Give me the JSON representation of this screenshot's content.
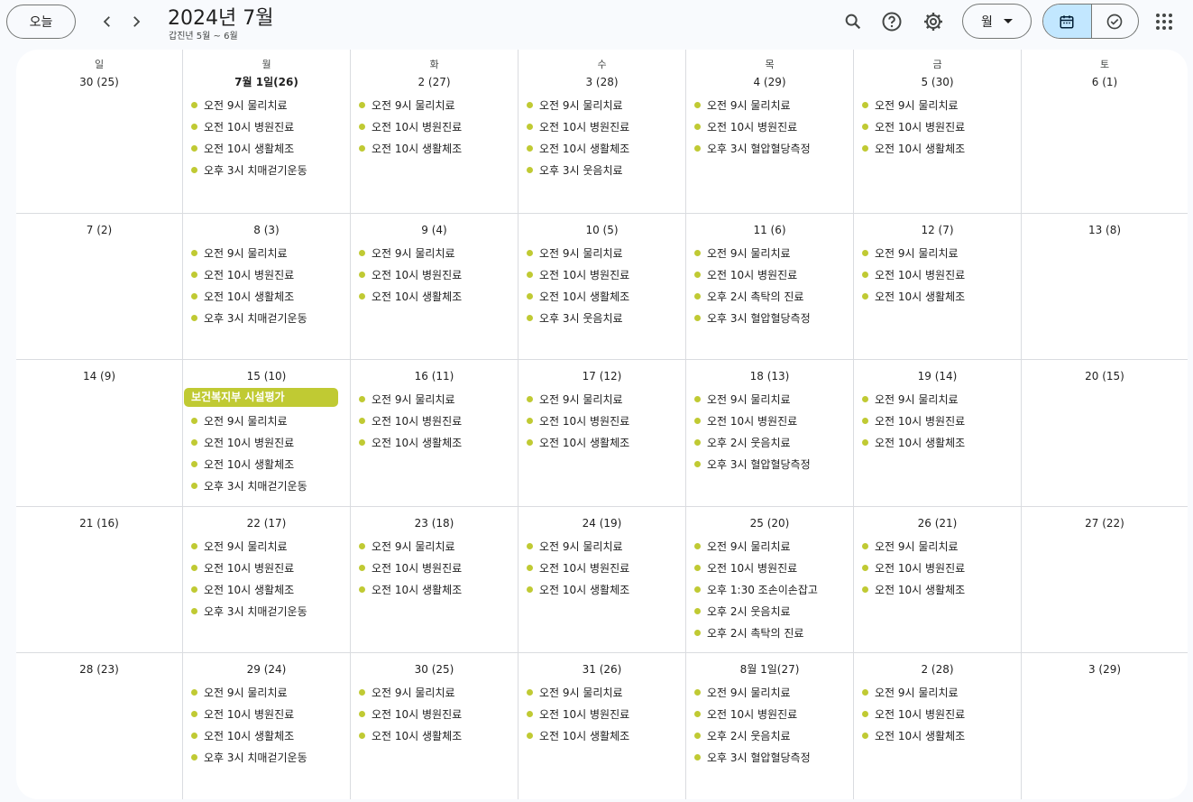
{
  "header": {
    "today_label": "오늘",
    "title": "2024년 7월",
    "subtitle": "갑진년 5월 ~ 6월",
    "view_label": "월",
    "icons": [
      "chevron-left-icon",
      "chevron-right-icon",
      "search-icon",
      "help-icon",
      "gear-icon",
      "calendar-icon",
      "tasks-icon",
      "apps-grid-icon"
    ]
  },
  "colors": {
    "event": "#c0ca33",
    "accent": "#c2e7ff"
  },
  "weekdays": [
    "일",
    "월",
    "화",
    "수",
    "목",
    "금",
    "토"
  ],
  "weeks": [
    [
      {
        "date": "30 (25)",
        "events": []
      },
      {
        "date": "7월 1일(26)",
        "bold": true,
        "events": [
          "오전 9시 물리치료",
          "오전 10시 병원진료",
          "오전 10시 생활체조",
          "오후 3시 치매걷기운동"
        ]
      },
      {
        "date": "2 (27)",
        "events": [
          "오전 9시 물리치료",
          "오전 10시 병원진료",
          "오전 10시 생활체조"
        ]
      },
      {
        "date": "3 (28)",
        "events": [
          "오전 9시 물리치료",
          "오전 10시 병원진료",
          "오전 10시 생활체조",
          "오후 3시 웃음치료"
        ]
      },
      {
        "date": "4 (29)",
        "events": [
          "오전 9시 물리치료",
          "오전 10시 병원진료",
          "오후 3시 혈압혈당측정"
        ]
      },
      {
        "date": "5 (30)",
        "events": [
          "오전 9시 물리치료",
          "오전 10시 병원진료",
          "오전 10시 생활체조"
        ]
      },
      {
        "date": "6 (1)",
        "events": []
      }
    ],
    [
      {
        "date": "7 (2)",
        "events": []
      },
      {
        "date": "8 (3)",
        "events": [
          "오전 9시 물리치료",
          "오전 10시 병원진료",
          "오전 10시 생활체조",
          "오후 3시 치매걷기운동"
        ]
      },
      {
        "date": "9 (4)",
        "events": [
          "오전 9시 물리치료",
          "오전 10시 병원진료",
          "오전 10시 생활체조"
        ]
      },
      {
        "date": "10 (5)",
        "events": [
          "오전 9시 물리치료",
          "오전 10시 병원진료",
          "오전 10시 생활체조",
          "오후 3시 웃음치료"
        ]
      },
      {
        "date": "11 (6)",
        "events": [
          "오전 9시 물리치료",
          "오전 10시 병원진료",
          "오후 2시 촉탁의 진료",
          "오후 3시 혈압혈당측정"
        ]
      },
      {
        "date": "12 (7)",
        "events": [
          "오전 9시 물리치료",
          "오전 10시 병원진료",
          "오전 10시 생활체조"
        ]
      },
      {
        "date": "13 (8)",
        "events": []
      }
    ],
    [
      {
        "date": "14 (9)",
        "events": []
      },
      {
        "date": "15 (10)",
        "allday": "보건복지부 시설평가",
        "events": [
          "오전 9시 물리치료",
          "오전 10시 병원진료",
          "오전 10시 생활체조",
          "오후 3시 치매걷기운동"
        ]
      },
      {
        "date": "16 (11)",
        "events": [
          "오전 9시 물리치료",
          "오전 10시 병원진료",
          "오전 10시 생활체조"
        ]
      },
      {
        "date": "17 (12)",
        "events": [
          "오전 9시 물리치료",
          "오전 10시 병원진료",
          "오전 10시 생활체조"
        ]
      },
      {
        "date": "18 (13)",
        "events": [
          "오전 9시 물리치료",
          "오전 10시 병원진료",
          "오후 2시 웃음치료",
          "오후 3시 혈압혈당측정"
        ]
      },
      {
        "date": "19 (14)",
        "events": [
          "오전 9시 물리치료",
          "오전 10시 병원진료",
          "오전 10시 생활체조"
        ]
      },
      {
        "date": "20 (15)",
        "events": []
      }
    ],
    [
      {
        "date": "21 (16)",
        "events": []
      },
      {
        "date": "22 (17)",
        "events": [
          "오전 9시 물리치료",
          "오전 10시 병원진료",
          "오전 10시 생활체조",
          "오후 3시 치매걷기운동"
        ]
      },
      {
        "date": "23 (18)",
        "events": [
          "오전 9시 물리치료",
          "오전 10시 병원진료",
          "오전 10시 생활체조"
        ]
      },
      {
        "date": "24 (19)",
        "events": [
          "오전 9시 물리치료",
          "오전 10시 병원진료",
          "오전 10시 생활체조"
        ]
      },
      {
        "date": "25 (20)",
        "events": [
          "오전 9시 물리치료",
          "오전 10시 병원진료",
          "오후 1:30 조손이손잡고",
          "오후 2시 웃음치료",
          "오후 2시 촉탁의 진료"
        ]
      },
      {
        "date": "26 (21)",
        "events": [
          "오전 9시 물리치료",
          "오전 10시 병원진료",
          "오전 10시 생활체조"
        ]
      },
      {
        "date": "27 (22)",
        "events": []
      }
    ],
    [
      {
        "date": "28 (23)",
        "events": []
      },
      {
        "date": "29 (24)",
        "events": [
          "오전 9시 물리치료",
          "오전 10시 병원진료",
          "오전 10시 생활체조",
          "오후 3시 치매걷기운동"
        ]
      },
      {
        "date": "30 (25)",
        "events": [
          "오전 9시 물리치료",
          "오전 10시 병원진료",
          "오전 10시 생활체조"
        ]
      },
      {
        "date": "31 (26)",
        "events": [
          "오전 9시 물리치료",
          "오전 10시 병원진료",
          "오전 10시 생활체조"
        ]
      },
      {
        "date": "8월 1일(27)",
        "events": [
          "오전 9시 물리치료",
          "오전 10시 병원진료",
          "오후 2시 웃음치료",
          "오후 3시 혈압혈당측정"
        ]
      },
      {
        "date": "2 (28)",
        "events": [
          "오전 9시 물리치료",
          "오전 10시 병원진료",
          "오전 10시 생활체조"
        ]
      },
      {
        "date": "3 (29)",
        "events": []
      }
    ]
  ]
}
